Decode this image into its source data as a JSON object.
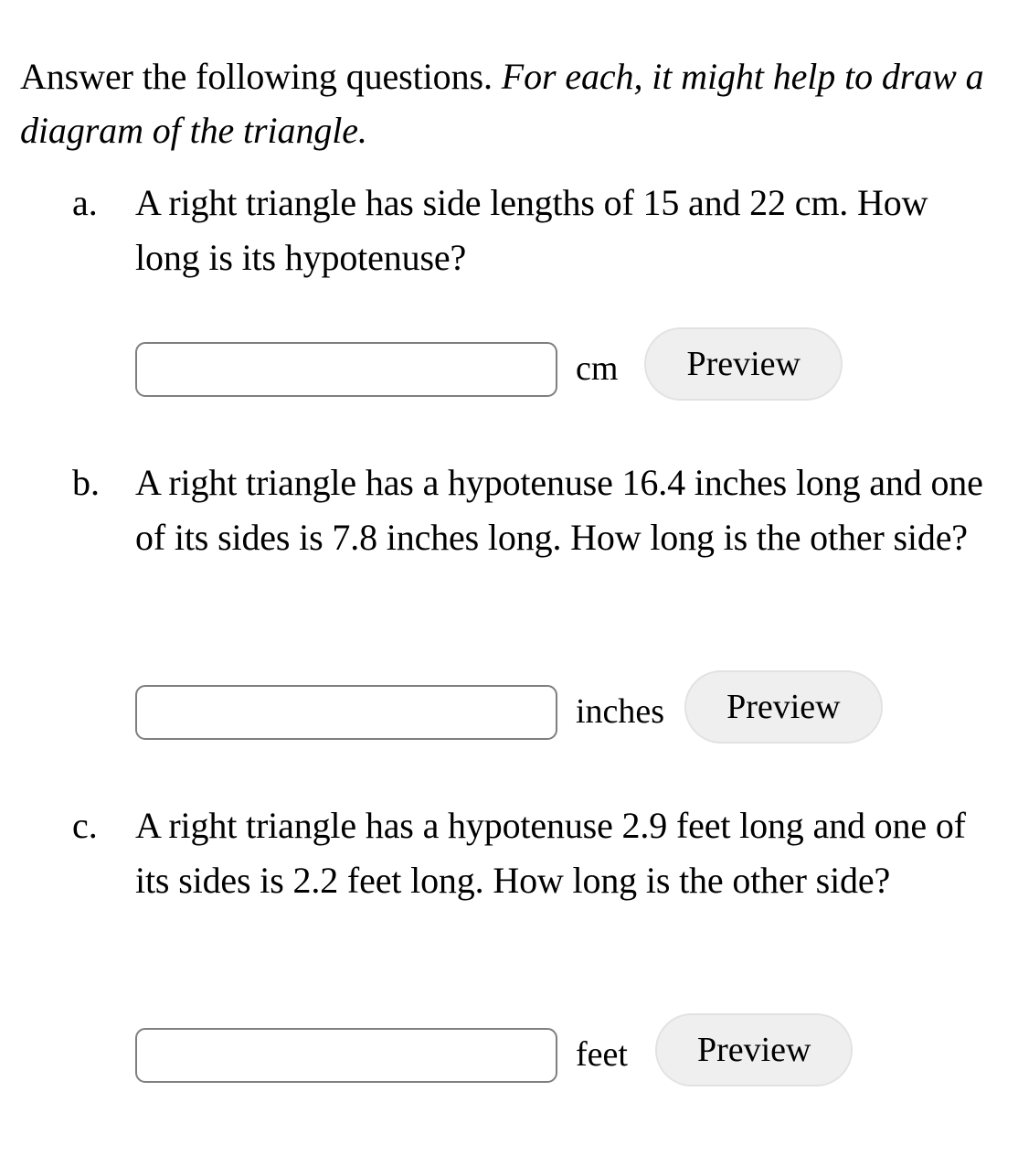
{
  "intro": {
    "roman_part": "Answer the following questions.",
    "italic_part": "For each, it might help to draw a diagram of the triangle."
  },
  "questions": [
    {
      "marker": "a.",
      "text": "A right triangle has side lengths of 15 and 22 cm. How long is its hypotenuse?",
      "answer": {
        "value": "",
        "placeholder": "",
        "unit": "cm",
        "preview_label": "Preview"
      }
    },
    {
      "marker": "b.",
      "text": "A right triangle has a hypotenuse 16.4 inches long and one of its sides is 7.8 inches long. How long is the other side?",
      "answer": {
        "value": "",
        "placeholder": "",
        "unit": "inches",
        "preview_label": "Preview"
      }
    },
    {
      "marker": "c.",
      "text": "A right triangle has a hypotenuse 2.9 feet long and one of its sides is 2.2 feet long. How long is the other side?",
      "answer": {
        "value": "",
        "placeholder": "",
        "unit": "feet",
        "preview_label": "Preview"
      }
    }
  ],
  "colors": {
    "page_background": "#ffffff",
    "text": "#000000",
    "input_border": "#7f7f7f",
    "input_background": "#ffffff",
    "button_background": "#efefef",
    "button_border": "#e2e2e2"
  }
}
